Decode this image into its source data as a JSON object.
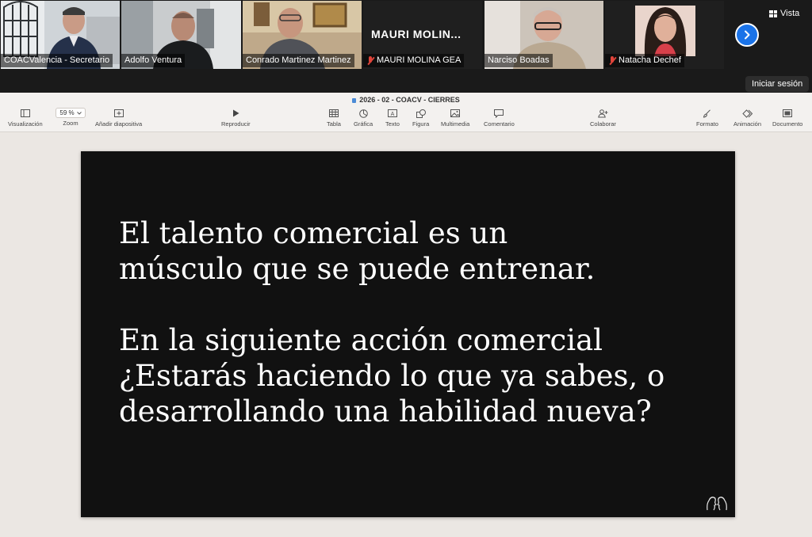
{
  "meeting": {
    "participants": [
      {
        "name": "COACValencia - Secretario",
        "muted": false,
        "active": false,
        "bg": "#5b6a78"
      },
      {
        "name": "Adolfo Ventura",
        "muted": false,
        "active": true,
        "bg": "#c9ccce"
      },
      {
        "name": "Conrado Martinez Martinez",
        "muted": false,
        "active": false,
        "bg": "#a08e76"
      },
      {
        "name": "MAURI MOLINA GEA",
        "muted": true,
        "active": false,
        "bg": "#1f1f1f",
        "display_text": "MAURI  MOLIN..."
      },
      {
        "name": "Narciso Boadas",
        "muted": false,
        "active": false,
        "bg": "#b7aea5"
      },
      {
        "name": "Natacha Dechef",
        "muted": true,
        "active": false,
        "bg": "#1f1f1f"
      }
    ],
    "view_label": "Vista",
    "login_label": "Iniciar sesión",
    "next_icon": "chevron-right-icon"
  },
  "keynote": {
    "title": "2026 - 02 - COACV - CIERRES",
    "zoom_value": "59 %",
    "toolbar": {
      "visualizacion": "Visualización",
      "zoom": "Zoom",
      "anadir_diapositiva": "Añadir diapositiva",
      "reproducir": "Reproducir",
      "tabla": "Tabla",
      "grafica": "Gráfica",
      "texto": "Texto",
      "figura": "Figura",
      "multimedia": "Multimedia",
      "comentario": "Comentario",
      "colaborar": "Colaborar",
      "formato": "Formato",
      "animacion": "Animación",
      "documento": "Documento"
    }
  },
  "slide": {
    "text": "El talento comercial es un\nmúsculo que se puede entrenar.\n\nEn la siguiente acción comercial\n¿Estarás haciendo lo que ya sabes, o\ndesarrollando una habilidad nueva?",
    "background": "#111111",
    "text_color": "#ffffff"
  }
}
